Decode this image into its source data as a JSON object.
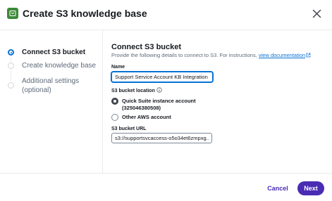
{
  "header": {
    "title": "Create S3 knowledge base",
    "icon": "knowledge-base-icon"
  },
  "steps": [
    {
      "label": "Connect S3 bucket",
      "state": "active"
    },
    {
      "label": "Create knowledge base",
      "state": "inactive"
    },
    {
      "label_line1": "Additional settings",
      "label_line2": "(optional)",
      "state": "inactive"
    }
  ],
  "main": {
    "title": "Connect S3 bucket",
    "description_prefix": "Provide the following details to connect to S3. For instructions,",
    "description_link": "view documentation",
    "name_label": "Name",
    "name_value": "Support Service Account KB Integration",
    "location_label": "S3 bucket location",
    "location_options": [
      {
        "label_line1": "Quick Suite instance account",
        "label_line2": "(325046380508)",
        "checked": true
      },
      {
        "label_line1": "Other AWS account",
        "label_line2": "",
        "checked": false
      }
    ],
    "url_label": "S3 bucket URL",
    "url_value": "s3://supportsvcaccess-o5o34et6zmpxg..."
  },
  "footer": {
    "cancel_label": "Cancel",
    "next_label": "Next"
  },
  "colors": {
    "accent": "#4a2bb4",
    "link": "#0972d3",
    "icon_bg": "#3c8a3a"
  }
}
